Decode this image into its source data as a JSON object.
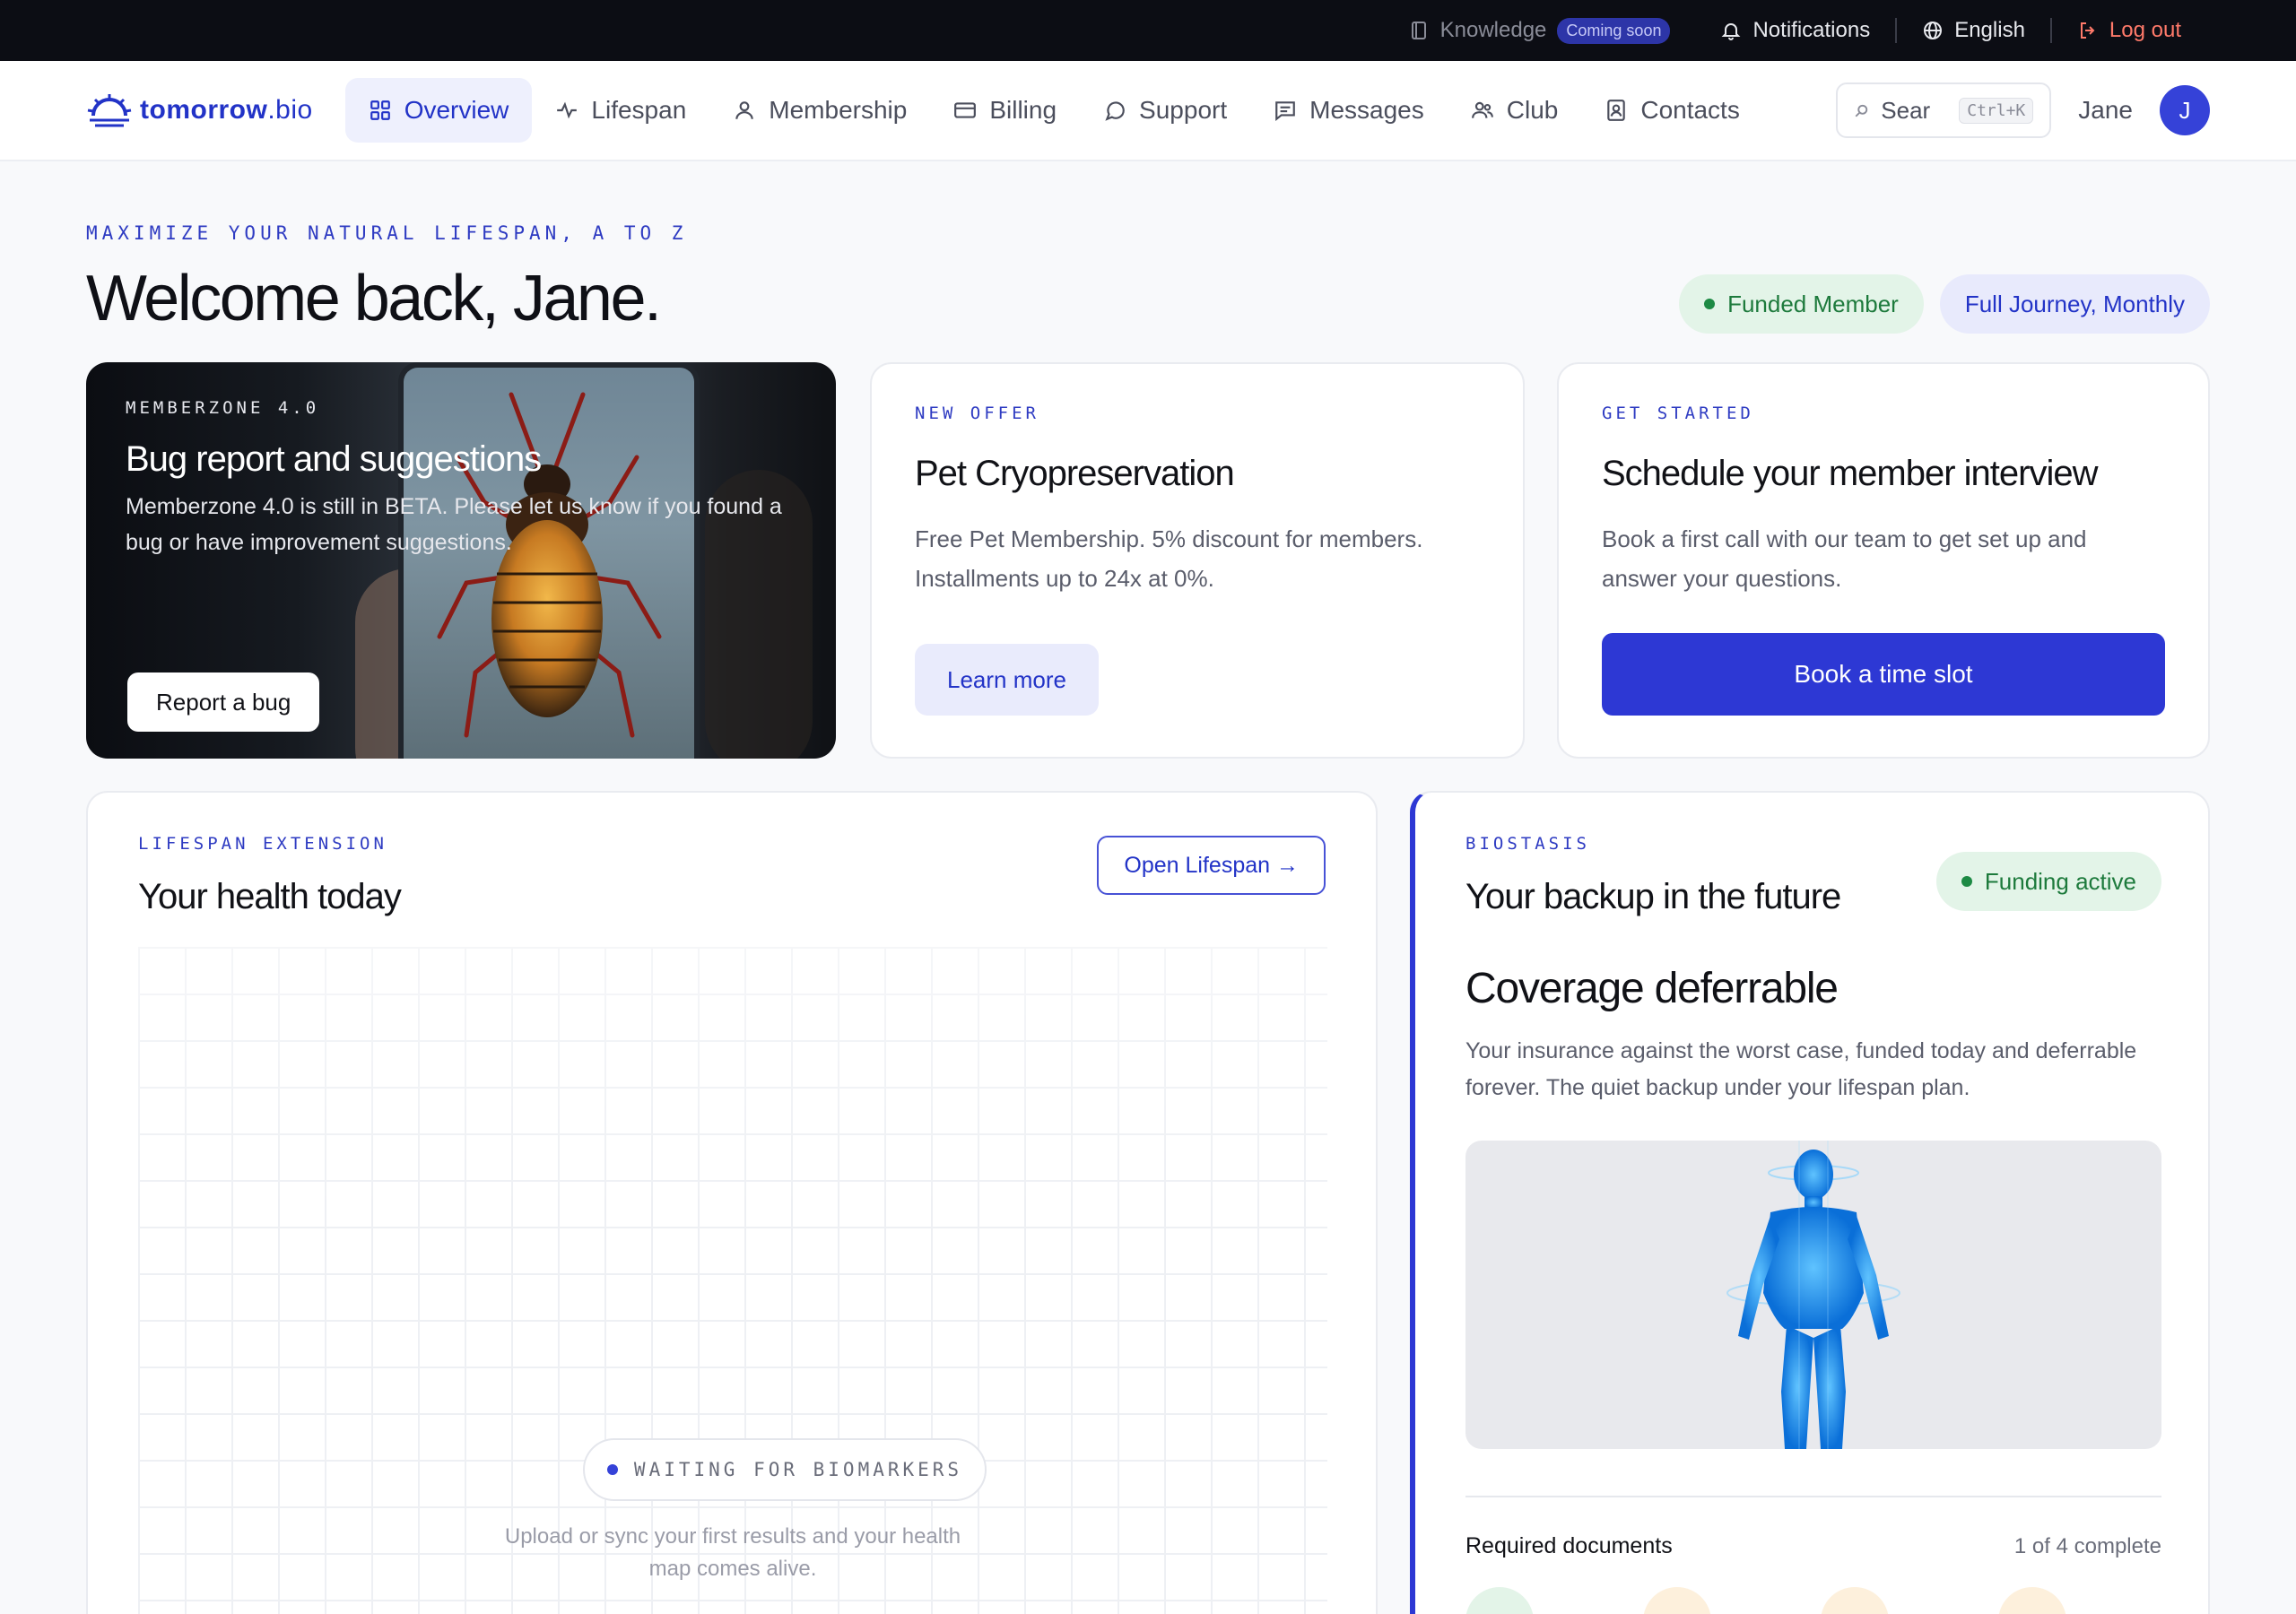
{
  "topbar": {
    "knowledge_label": "Knowledge",
    "coming_soon_badge": "Coming soon",
    "notifications_label": "Notifications",
    "language_label": "English",
    "logout_label": "Log out"
  },
  "nav": {
    "logo": {
      "brand": "tomorrow",
      "suffix": ".bio"
    },
    "items": [
      {
        "label": "Overview",
        "icon": "grid-icon",
        "active": true
      },
      {
        "label": "Lifespan",
        "icon": "pulse-icon"
      },
      {
        "label": "Membership",
        "icon": "user-icon"
      },
      {
        "label": "Billing",
        "icon": "credit-card-icon"
      },
      {
        "label": "Support",
        "icon": "chat-bubble-icon"
      },
      {
        "label": "Messages",
        "icon": "message-square-icon"
      },
      {
        "label": "Club",
        "icon": "users-icon"
      },
      {
        "label": "Contacts",
        "icon": "contact-card-icon"
      }
    ],
    "search_placeholder": "Sear",
    "search_shortcut": "Ctrl+K",
    "user_name": "Jane",
    "avatar_initial": "J"
  },
  "header": {
    "kicker": "MAXIMIZE YOUR NATURAL LIFESPAN, A TO Z",
    "welcome": "Welcome back, Jane.",
    "member_status": "Funded Member",
    "plan": "Full Journey, Monthly"
  },
  "bug_card": {
    "kicker": "MEMBERZONE 4.0",
    "title": "Bug report and suggestions",
    "body": "Memberzone 4.0 is still in BETA. Please let us know if you found a bug or have improvement suggestions.",
    "button": "Report a bug"
  },
  "offer_card": {
    "kicker": "NEW OFFER",
    "title": "Pet Cryopreservation",
    "body": "Free Pet Membership. 5% discount for members. Installments up to 24x at 0%.",
    "button": "Learn more"
  },
  "start_card": {
    "kicker": "GET STARTED",
    "title": "Schedule your member interview",
    "body": "Book a first call with our team to get set up and answer your questions.",
    "button": "Book a time slot"
  },
  "health_card": {
    "kicker": "LIFESPAN EXTENSION",
    "title": "Your health today",
    "button": "Open Lifespan →",
    "waiting": "WAITING FOR BIOMARKERS",
    "waiting_sub": "Upload or sync your first results and your health map comes alive."
  },
  "bio_card": {
    "kicker": "BIOSTASIS",
    "title": "Your backup in the future",
    "status": "Funding active",
    "heading": "Coverage deferrable",
    "body": "Your insurance against the worst case, funded today and deferrable forever. The quiet backup under your lifespan plan.",
    "docs_title": "Required documents",
    "docs_count": "1 of 4 complete"
  },
  "colors": {
    "brand": "#2233c7",
    "primary_button": "#2d38d4",
    "success": "#1d8a44",
    "topbar": "#0c0d14",
    "logout": "#ff7a6a"
  }
}
